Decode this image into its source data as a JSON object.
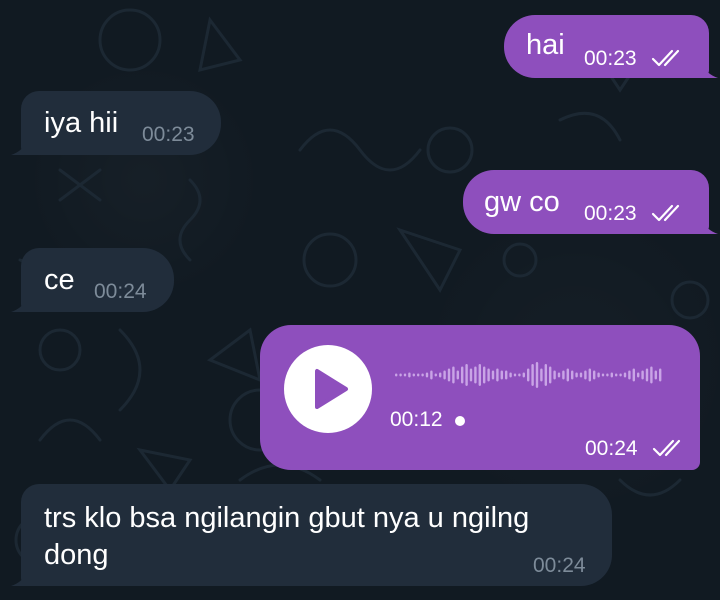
{
  "messages": [
    {
      "direction": "outgoing",
      "text": "hai",
      "time": "00:23",
      "status": "read"
    },
    {
      "direction": "incoming",
      "text": "iya hii",
      "time": "00:23"
    },
    {
      "direction": "outgoing",
      "text": "gw co",
      "time": "00:23",
      "status": "read"
    },
    {
      "direction": "incoming",
      "text": "ce",
      "time": "00:24"
    },
    {
      "direction": "outgoing",
      "type": "voice",
      "duration": "00:12",
      "time": "00:24",
      "status": "read"
    },
    {
      "direction": "incoming",
      "text_line1": "trs klo bsa ngilangin gbut nya u ngilng",
      "text_line2": "dong",
      "time": "00:24"
    }
  ],
  "colors": {
    "outgoing_bubble": "#8e4fbd",
    "incoming_bubble": "#212d3b",
    "background": "#111a22",
    "incoming_time": "#7d8b99"
  },
  "icons": {
    "read_receipt": "double-check-icon",
    "voice_play": "play-icon",
    "unplayed_dot": "unplayed-dot-icon"
  }
}
